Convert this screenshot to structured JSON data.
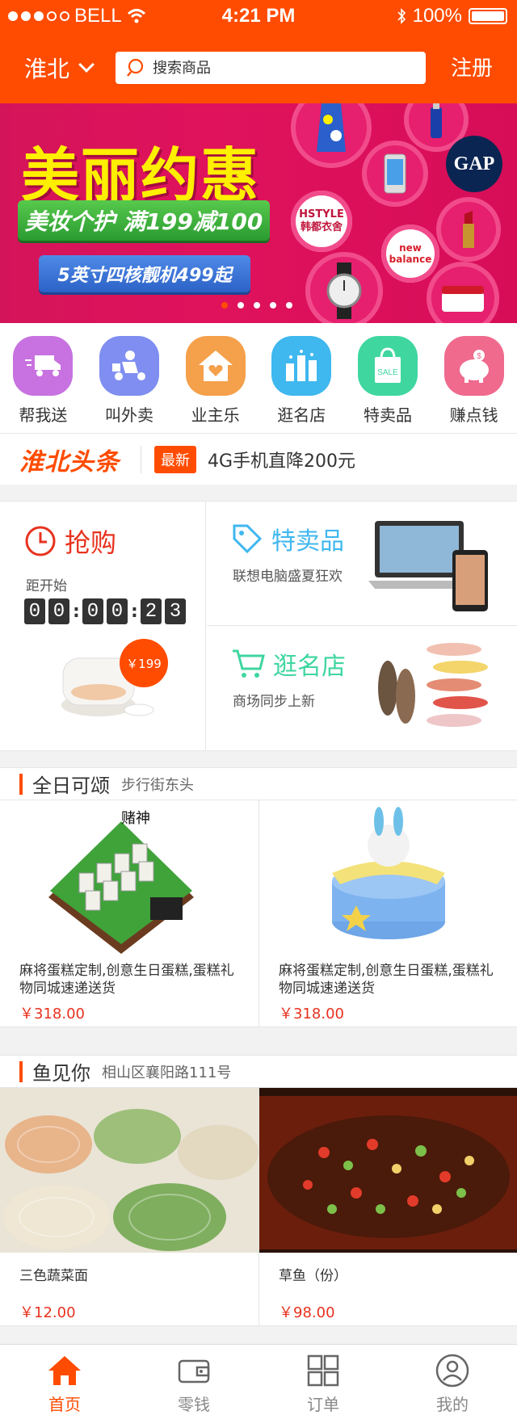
{
  "status_bar": {
    "carrier": "BELL",
    "time": "4:21 PM",
    "battery": "100%"
  },
  "header": {
    "city": "淮北",
    "search_placeholder": "搜索商品",
    "register": "注册"
  },
  "banner": {
    "title": "美丽约惠",
    "line1": "美妆个护 满199减100",
    "line2": "5英寸四核靓机499起",
    "brands": [
      "GAP",
      "HSTYLE 韩都衣舍",
      "new balance"
    ],
    "dots": 5,
    "active_dot": 0
  },
  "quick_nav": [
    {
      "label": "帮我送",
      "icon": "truck-icon",
      "color": "#c772e0"
    },
    {
      "label": "叫外卖",
      "icon": "delivery-scooter-icon",
      "color": "#7f8ef0"
    },
    {
      "label": "业主乐",
      "icon": "house-heart-icon",
      "color": "#f5a04a"
    },
    {
      "label": "逛名店",
      "icon": "city-buildings-icon",
      "color": "#3fb7ef"
    },
    {
      "label": "特卖品",
      "icon": "sale-bag-icon",
      "color": "#3fd6a0"
    },
    {
      "label": "赚点钱",
      "icon": "piggy-bank-icon",
      "color": "#f06a8e"
    }
  ],
  "headline": {
    "logo": "淮北头条",
    "badge": "最新",
    "text": "4G手机直降200元"
  },
  "flash_sale": {
    "title": "抢购",
    "countdown_label": "距开始",
    "digits": [
      "0",
      "0",
      "0",
      "0",
      "2",
      "3"
    ],
    "price": "￥199"
  },
  "special_sale": {
    "title": "特卖品",
    "subtitle": "联想电脑盛夏狂欢",
    "color": "#3fb7ef"
  },
  "famous_store": {
    "title": "逛名店",
    "subtitle": "商场同步上新",
    "color": "#3fd6a0"
  },
  "section1": {
    "title": "全日可颂",
    "subtitle": "步行街东头",
    "items": [
      {
        "title": "麻将蛋糕定制,创意生日蛋糕,蛋糕礼物同城速递送货",
        "price": "￥318.00"
      },
      {
        "title": "麻将蛋糕定制,创意生日蛋糕,蛋糕礼物同城速递送货",
        "price": "￥318.00"
      }
    ]
  },
  "section2": {
    "title": "鱼见你",
    "subtitle": "相山区襄阳路111号",
    "items": [
      {
        "title": "三色蔬菜面",
        "price": "￥12.00"
      },
      {
        "title": "草鱼（份）",
        "price": "￥98.00"
      }
    ]
  },
  "tabbar": [
    {
      "label": "首页",
      "icon": "home-icon",
      "active": true
    },
    {
      "label": "零钱",
      "icon": "wallet-icon",
      "active": false
    },
    {
      "label": "订单",
      "icon": "orders-icon",
      "active": false
    },
    {
      "label": "我的",
      "icon": "profile-icon",
      "active": false
    }
  ],
  "colors": {
    "brand": "#ff4c00",
    "price": "#e8321e"
  }
}
